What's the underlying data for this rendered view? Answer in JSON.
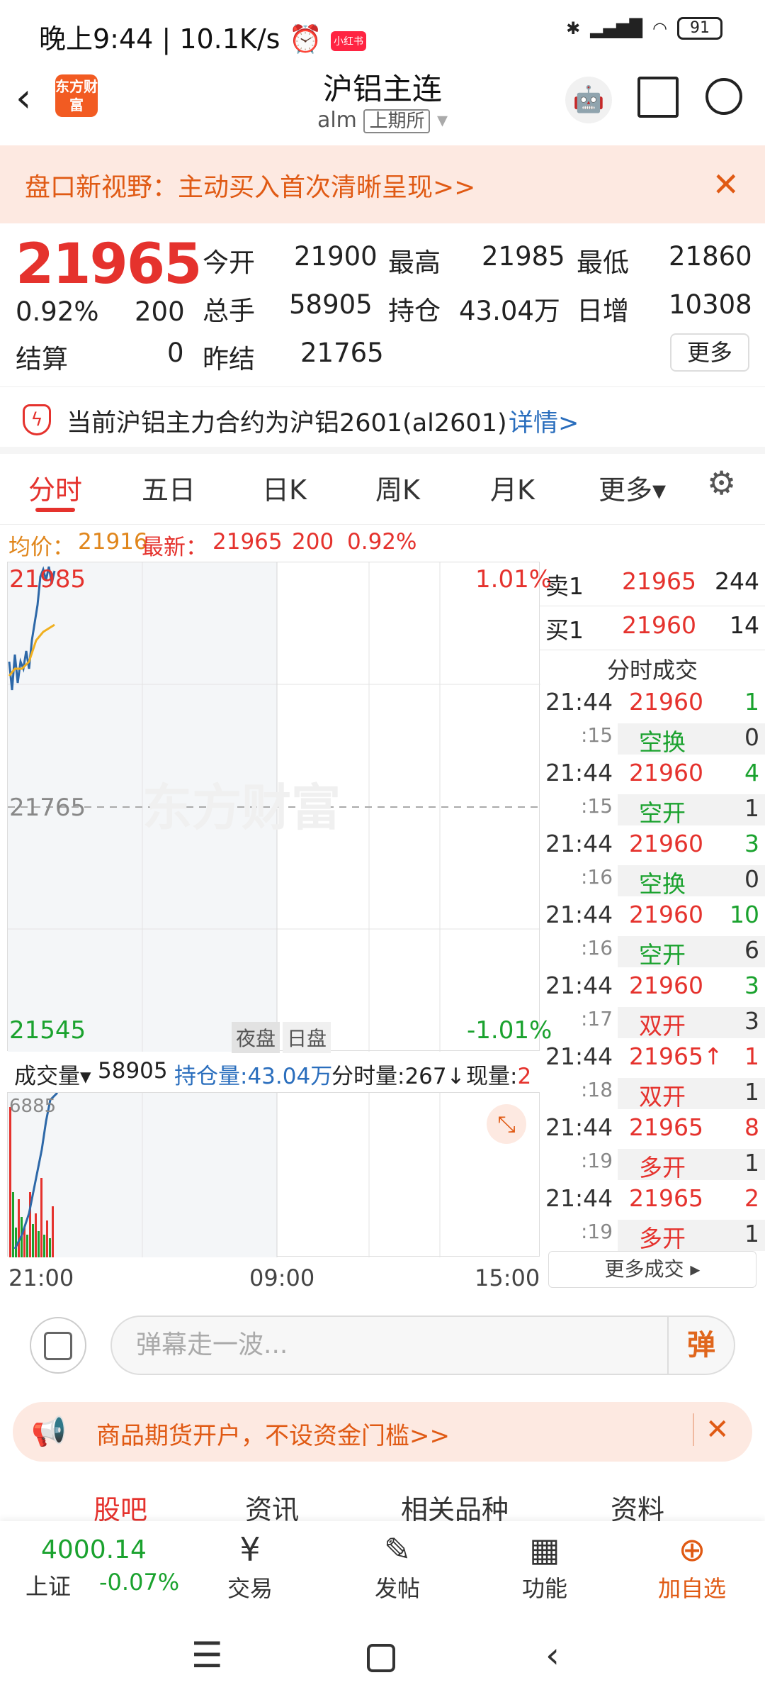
{
  "status": {
    "time": "晚上9:44",
    "speed": "10.1K/s",
    "battery": "91",
    "app_badge": "小红书"
  },
  "header": {
    "title": "沪铝主连",
    "code": "alm",
    "exchange": "上期所",
    "logo": "东方财富"
  },
  "banner1": {
    "text": "盘口新视野：主动买入首次清晰呈现>>"
  },
  "quote": {
    "price": "21965",
    "change_pct": "0.92%",
    "change": "200",
    "open_label": "今开",
    "open": "21900",
    "high_label": "最高",
    "high": "21985",
    "low_label": "最低",
    "low": "21860",
    "volume_label": "总手",
    "volume": "58905",
    "oi_label": "持仓",
    "oi": "43.04万",
    "daily_inc_label": "日增",
    "daily_inc": "10308",
    "settle_label": "结算",
    "settle": "0",
    "prev_settle_label": "昨结",
    "prev_settle": "21765",
    "more_label": "更多"
  },
  "notice": {
    "text": "当前沪铝主力合约为沪铝2601(al2601)",
    "link": "详情>"
  },
  "tabs": [
    {
      "label": "分时"
    },
    {
      "label": "五日"
    },
    {
      "label": "日K"
    },
    {
      "label": "周K"
    },
    {
      "label": "月K"
    },
    {
      "label": "更多▾"
    }
  ],
  "infoline": {
    "avg_label": "均价：",
    "avg": "21916",
    "latest_label": "最新：",
    "latest": "21965",
    "chg": "200",
    "pct": "0.92%"
  },
  "chart": {
    "top_price": "21985",
    "top_pct": "1.01%",
    "mid_price": "21765",
    "bottom_price": "21545",
    "bottom_pct": "-1.01%",
    "night_label": "夜盘",
    "day_label": "日盘",
    "watermark": "东方财富"
  },
  "volume_bar": {
    "vol_label": "成交量▾",
    "vol": "58905",
    "oi_label": "持仓量:43.04万",
    "tick_label": "分时量:267↓",
    "now_label": "现量:",
    "now": "2",
    "max": "6885"
  },
  "time_axis": {
    "start": "21:00",
    "mid": "09:00",
    "end": "15:00"
  },
  "order_book": {
    "sell_label": "卖1",
    "sell_price": "21965",
    "sell_vol": "244",
    "buy_label": "买1",
    "buy_price": "21960",
    "buy_vol": "14",
    "trades_title": "分时成交",
    "trades": [
      {
        "time": "21:44",
        "price": "21960",
        "qty": "1",
        "sec": ":15",
        "type": "空换",
        "oi": "0"
      },
      {
        "time": "21:44",
        "price": "21960",
        "qty": "4",
        "sec": ":15",
        "type": "空开",
        "oi": "1"
      },
      {
        "time": "21:44",
        "price": "21960",
        "qty": "3",
        "sec": ":16",
        "type": "空换",
        "oi": "0"
      },
      {
        "time": "21:44",
        "price": "21960",
        "qty": "10",
        "sec": ":16",
        "type": "空开",
        "oi": "6"
      },
      {
        "time": "21:44",
        "price": "21960",
        "qty": "3",
        "sec": ":17",
        "type": "双开",
        "oi": "3"
      },
      {
        "time": "21:44",
        "price": "21965↑",
        "qty": "1",
        "sec": ":18",
        "type": "双开",
        "oi": "1"
      },
      {
        "time": "21:44",
        "price": "21965",
        "qty": "8",
        "sec": ":19",
        "type": "多开",
        "oi": "1"
      },
      {
        "time": "21:44",
        "price": "21965",
        "qty": "2",
        "sec": ":19",
        "type": "多开",
        "oi": "1"
      }
    ],
    "more_trades": "更多成交 ▸"
  },
  "danmu": {
    "placeholder": "弹幕走一波...",
    "button": "弹"
  },
  "ad": {
    "text": "商品期货开户，不设资金门槛>>"
  },
  "bottom_tabs": [
    {
      "label": "股吧"
    },
    {
      "label": "资讯"
    },
    {
      "label": "相关品种"
    },
    {
      "label": "资料"
    }
  ],
  "bottom_nav": {
    "index_value": "4000.14",
    "index_name": "上证",
    "index_change": "-0.07%",
    "items": [
      {
        "label": "交易",
        "icon": "¥"
      },
      {
        "label": "发帖",
        "icon": "✎"
      },
      {
        "label": "功能",
        "icon": "▦"
      },
      {
        "label": "加自选",
        "icon": "⊕"
      }
    ]
  }
}
